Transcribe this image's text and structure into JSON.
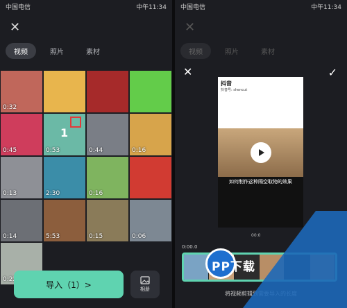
{
  "left": {
    "status": {
      "carrier": "中国电信",
      "time": "中午11:34"
    },
    "tabs": [
      {
        "label": "视频",
        "active": true
      },
      {
        "label": "照片",
        "active": false
      },
      {
        "label": "素材",
        "active": false
      }
    ],
    "thumbnails": [
      {
        "duration": "0:32",
        "color": "#c0675b"
      },
      {
        "duration": "",
        "color": "#e8b54d"
      },
      {
        "duration": "",
        "color": "#a62a2a"
      },
      {
        "duration": "",
        "color": "#63cc4a"
      },
      {
        "duration": "0:45",
        "color": "#cf3d5c"
      },
      {
        "duration": "0:53",
        "color": "#6bb9a6",
        "selected_number": "1"
      },
      {
        "duration": "0:44",
        "color": "#7a7e86"
      },
      {
        "duration": "0:16",
        "color": "#d7a44b"
      },
      {
        "duration": "0:13",
        "color": "#8e9096"
      },
      {
        "duration": "2:30",
        "color": "#3b8da8"
      },
      {
        "duration": "0:16",
        "color": "#7fb45f"
      },
      {
        "duration": "",
        "color": "#d13b32"
      },
      {
        "duration": "0:14",
        "color": "#6c6f75"
      },
      {
        "duration": "5:53",
        "color": "#8c5e3d"
      },
      {
        "duration": "0:15",
        "color": "#8a7b59"
      },
      {
        "duration": "0:06",
        "color": "#7d8893"
      },
      {
        "duration": "0:22",
        "color": "#a8b0a8"
      }
    ],
    "import_label": "导入（1）>",
    "album_label": "相册"
  },
  "right": {
    "status": {
      "carrier": "中国电信",
      "time": "中午11:34"
    },
    "tabs": [
      "视频",
      "照片",
      "素材"
    ],
    "preview": {
      "logo": "抖音",
      "account": "抖音号: shencut",
      "caption": "如何制作这种隔空取物的效果"
    },
    "clip_duration": "00:0",
    "time_start": "0:00.0",
    "hint": "将视频剪辑到需要导入的长度",
    "watermark": "PP下载"
  },
  "colors": {
    "accent": "#5fd3b0",
    "panel": "#1c1d22"
  }
}
